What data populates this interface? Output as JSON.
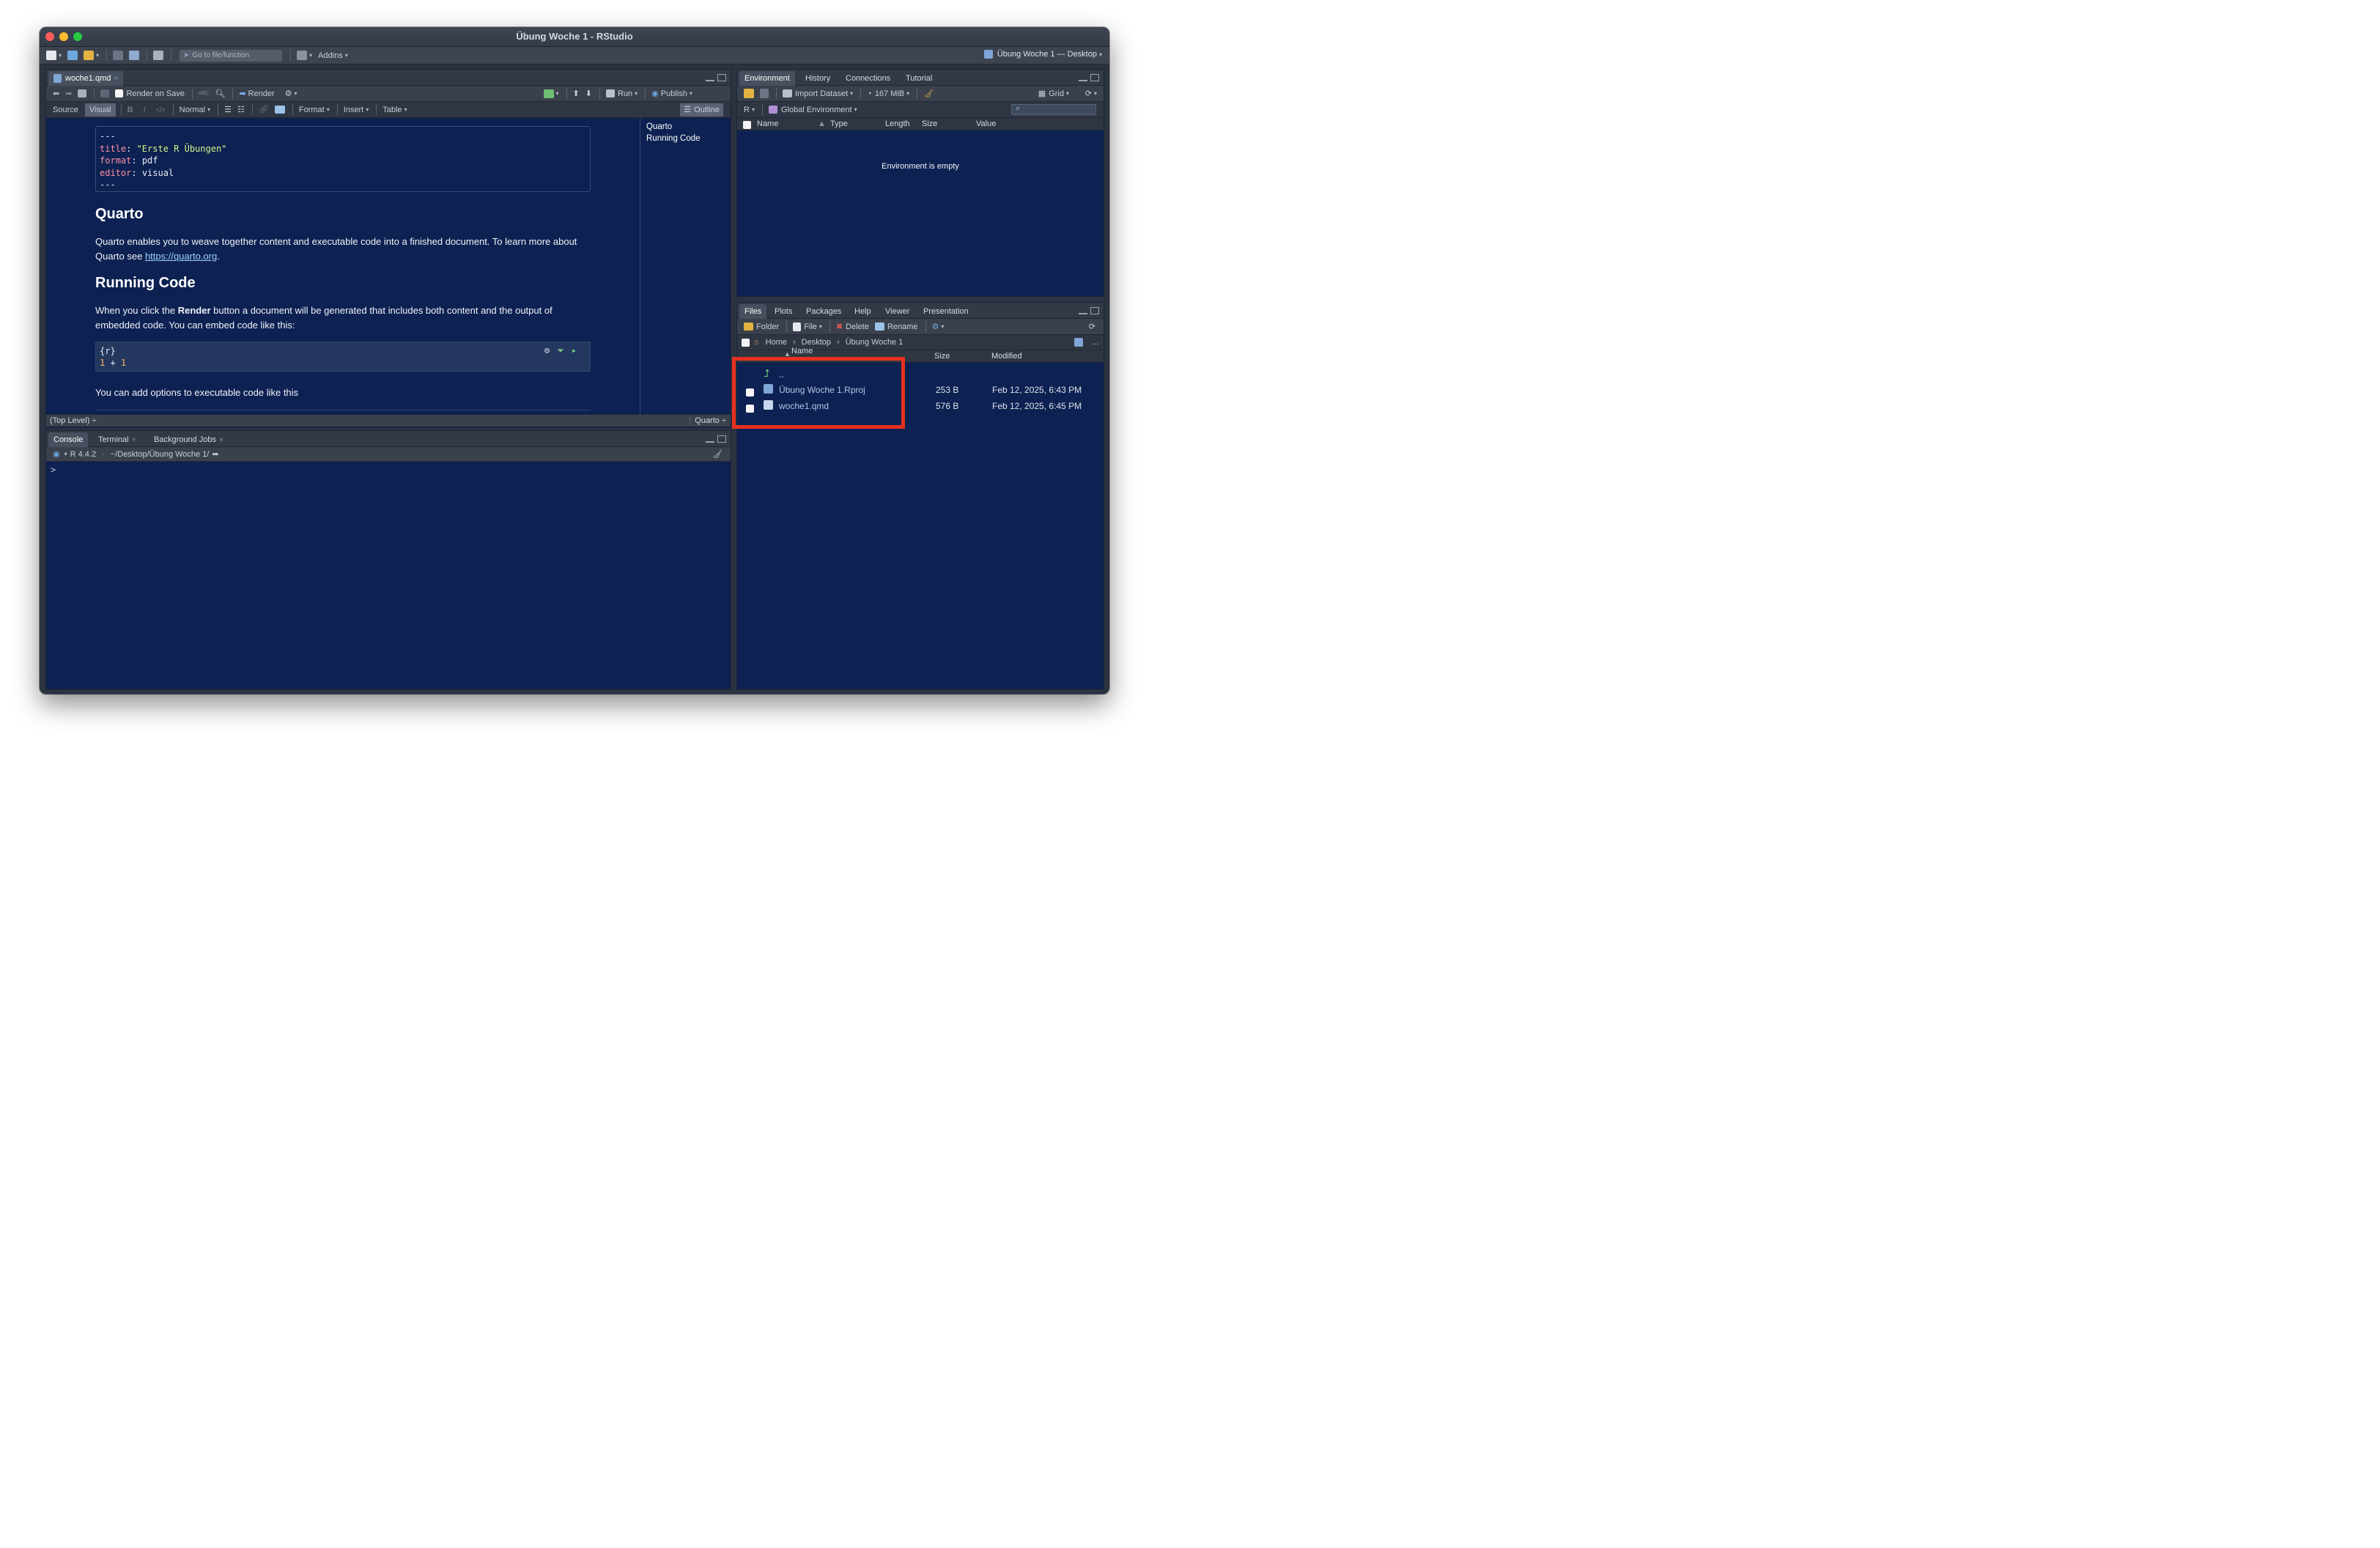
{
  "window": {
    "title": "Übung Woche 1 - RStudio",
    "project": "Übung Woche 1 — Desktop"
  },
  "main_toolbar": {
    "goto_placeholder": "Go to file/function",
    "addins": "Addins"
  },
  "editor": {
    "tab": "woche1.qmd",
    "toolbar": {
      "render_on_save": "Render on Save",
      "render": "Render",
      "run": "Run",
      "publish": "Publish"
    },
    "format_bar": {
      "source": "Source",
      "visual": "Visual",
      "bold": "B",
      "italic": "I",
      "code": "</>",
      "style": "Normal",
      "format": "Format",
      "insert": "Insert",
      "table": "Table",
      "outline": "Outline"
    },
    "yaml_lines": [
      {
        "key": "---",
        "val": ""
      },
      {
        "key": "title",
        "val": "\"Erste R Übungen\""
      },
      {
        "key": "format",
        "val": "pdf"
      },
      {
        "key": "editor",
        "val": "visual"
      },
      {
        "key": "---",
        "val": ""
      }
    ],
    "heading1": "Quarto",
    "para1_a": "Quarto enables you to weave together content and executable code into a finished document. To learn more about Quarto see ",
    "para1_link": "https://quarto.org",
    "para1_b": ".",
    "heading2": "Running Code",
    "para2_a": "When you click the ",
    "para2_bold": "Render",
    "para2_b": " button a document will be generated that includes both content and the output of embedded code. You can embed code like this:",
    "code_lang": "{r}",
    "code_num1": "1",
    "code_op": " + ",
    "code_num2": "1",
    "para3": "You can add options to executable code like this",
    "outline_items": [
      "Quarto",
      "Running Code"
    ],
    "status_left": "(Top Level) ÷",
    "status_right": "Quarto ÷"
  },
  "console": {
    "tabs": [
      "Console",
      "Terminal",
      "Background Jobs"
    ],
    "r_version": "R 4.4.2",
    "path": "~/Desktop/Übung Woche 1/",
    "prompt": ">"
  },
  "environment": {
    "tabs": [
      "Environment",
      "History",
      "Connections",
      "Tutorial"
    ],
    "import": "Import Dataset",
    "memory": "167 MiB",
    "grid": "Grid",
    "lang": "R",
    "scope": "Global Environment",
    "columns": [
      "Name",
      "Type",
      "Length",
      "Size",
      "Value"
    ],
    "empty": "Environment is empty"
  },
  "files": {
    "tabs": [
      "Files",
      "Plots",
      "Packages",
      "Help",
      "Viewer",
      "Presentation"
    ],
    "folder": "Folder",
    "file": "File",
    "delete": "Delete",
    "rename": "Rename",
    "breadcrumb": [
      "Home",
      "Desktop",
      "Übung Woche 1"
    ],
    "more": "...",
    "columns": {
      "name": "Name",
      "size": "Size",
      "modified": "Modified"
    },
    "parent": "..",
    "rows": [
      {
        "name": "Übung Woche 1.Rproj",
        "size": "253 B",
        "modified": "Feb 12, 2025, 6:43 PM"
      },
      {
        "name": "woche1.qmd",
        "size": "576 B",
        "modified": "Feb 12, 2025, 6:45 PM"
      }
    ]
  },
  "colors": {
    "pane_bg": "#0d2152",
    "chrome": "#3a414d",
    "highlight": "#e7301e"
  }
}
